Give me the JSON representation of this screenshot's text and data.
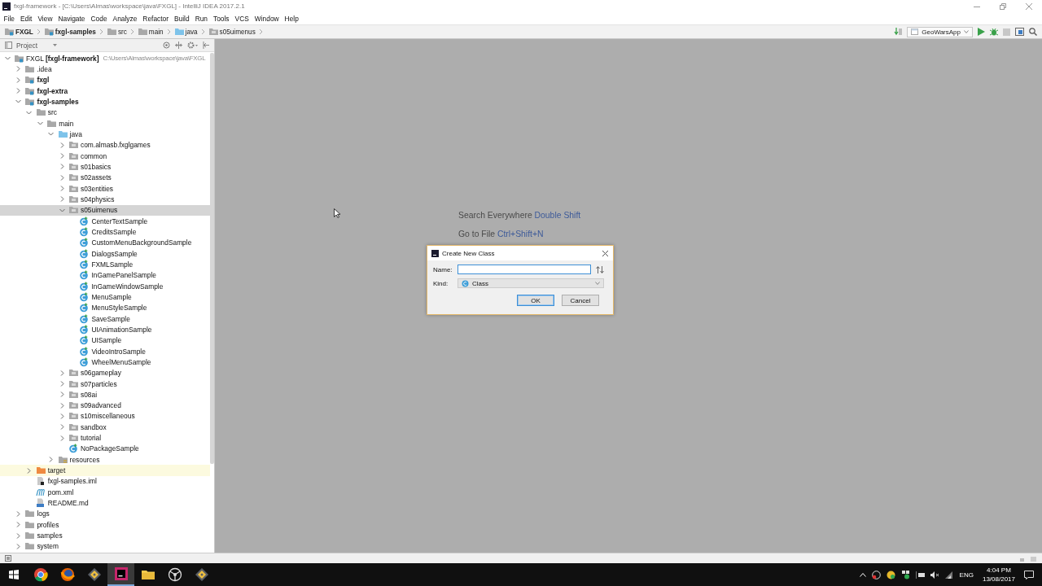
{
  "window": {
    "title": "fxgl-framework - [C:\\Users\\Almas\\workspace\\java\\FXGL] - IntelliJ IDEA 2017.2.1"
  },
  "menu": [
    "File",
    "Edit",
    "View",
    "Navigate",
    "Code",
    "Analyze",
    "Refactor",
    "Build",
    "Run",
    "Tools",
    "VCS",
    "Window",
    "Help"
  ],
  "breadcrumbs": [
    {
      "label": "FXGL",
      "kind": "module"
    },
    {
      "label": "fxgl-samples",
      "kind": "module"
    },
    {
      "label": "src",
      "kind": "folder"
    },
    {
      "label": "main",
      "kind": "folder"
    },
    {
      "label": "java",
      "kind": "source"
    },
    {
      "label": "s05uimenus",
      "kind": "package"
    }
  ],
  "toolbar": {
    "run_config": "GeoWarsApp",
    "stop_disabled": true
  },
  "project_panel": {
    "title": "Project",
    "tree": [
      {
        "label": "FXGL **[fxgl-framework]**",
        "path": "C:\\Users\\Almas\\workspace\\java\\FXGL",
        "kind": "project",
        "expanded": true,
        "selected": false,
        "children": [
          {
            "label": ".idea",
            "kind": "folder",
            "expanded": false,
            "selected": false
          },
          {
            "label": "fxgl",
            "kind": "module",
            "expanded": false,
            "selected": false
          },
          {
            "label": "fxgl-extra",
            "kind": "module",
            "expanded": false,
            "selected": false
          },
          {
            "label": "fxgl-samples",
            "kind": "module",
            "expanded": true,
            "selected": false,
            "children": [
              {
                "label": "src",
                "kind": "folder",
                "expanded": true,
                "selected": false,
                "children": [
                  {
                    "label": "main",
                    "kind": "folder",
                    "expanded": true,
                    "selected": false,
                    "children": [
                      {
                        "label": "java",
                        "kind": "source",
                        "expanded": true,
                        "selected": false,
                        "children": [
                          {
                            "label": "com.almasb.fxglgames",
                            "kind": "package",
                            "expanded": false,
                            "selected": false
                          },
                          {
                            "label": "common",
                            "kind": "package",
                            "expanded": false,
                            "selected": false
                          },
                          {
                            "label": "s01basics",
                            "kind": "package",
                            "expanded": false,
                            "selected": false
                          },
                          {
                            "label": "s02assets",
                            "kind": "package",
                            "expanded": false,
                            "selected": false
                          },
                          {
                            "label": "s03entities",
                            "kind": "package",
                            "expanded": false,
                            "selected": false
                          },
                          {
                            "label": "s04physics",
                            "kind": "package",
                            "expanded": false,
                            "selected": false
                          },
                          {
                            "label": "s05uimenus",
                            "kind": "package",
                            "expanded": true,
                            "selected": true,
                            "children": [
                              {
                                "label": "CenterTextSample",
                                "kind": "class",
                                "selected": false
                              },
                              {
                                "label": "CreditsSample",
                                "kind": "class",
                                "selected": false
                              },
                              {
                                "label": "CustomMenuBackgroundSample",
                                "kind": "class",
                                "selected": false
                              },
                              {
                                "label": "DialogsSample",
                                "kind": "class",
                                "selected": false
                              },
                              {
                                "label": "FXMLSample",
                                "kind": "class",
                                "selected": false
                              },
                              {
                                "label": "InGamePanelSample",
                                "kind": "class",
                                "selected": false
                              },
                              {
                                "label": "InGameWindowSample",
                                "kind": "class",
                                "selected": false
                              },
                              {
                                "label": "MenuSample",
                                "kind": "class",
                                "selected": false
                              },
                              {
                                "label": "MenuStyleSample",
                                "kind": "class",
                                "selected": false
                              },
                              {
                                "label": "SaveSample",
                                "kind": "class",
                                "selected": false
                              },
                              {
                                "label": "UIAnimationSample",
                                "kind": "class",
                                "selected": false
                              },
                              {
                                "label": "UISample",
                                "kind": "class",
                                "selected": false
                              },
                              {
                                "label": "VideoIntroSample",
                                "kind": "class",
                                "selected": false
                              },
                              {
                                "label": "WheelMenuSample",
                                "kind": "class",
                                "selected": false
                              }
                            ]
                          },
                          {
                            "label": "s06gameplay",
                            "kind": "package",
                            "expanded": false,
                            "selected": false
                          },
                          {
                            "label": "s07particles",
                            "kind": "package",
                            "expanded": false,
                            "selected": false
                          },
                          {
                            "label": "s08ai",
                            "kind": "package",
                            "expanded": false,
                            "selected": false
                          },
                          {
                            "label": "s09advanced",
                            "kind": "package",
                            "expanded": false,
                            "selected": false
                          },
                          {
                            "label": "s10miscellaneous",
                            "kind": "package",
                            "expanded": false,
                            "selected": false
                          },
                          {
                            "label": "sandbox",
                            "kind": "package",
                            "expanded": false,
                            "selected": false
                          },
                          {
                            "label": "tutorial",
                            "kind": "package",
                            "expanded": false,
                            "selected": false
                          },
                          {
                            "label": "NoPackageSample",
                            "kind": "class",
                            "selected": false
                          }
                        ]
                      },
                      {
                        "label": "resources",
                        "kind": "resources",
                        "expanded": false,
                        "selected": false
                      }
                    ]
                  }
                ]
              },
              {
                "label": "target",
                "kind": "excluded",
                "expanded": false,
                "selected": false
              },
              {
                "label": "fxgl-samples.iml",
                "kind": "iml",
                "selected": false
              },
              {
                "label": "pom.xml",
                "kind": "pom",
                "selected": false
              },
              {
                "label": "README.md",
                "kind": "markdown",
                "selected": false
              }
            ]
          },
          {
            "label": "logs",
            "kind": "folder",
            "expanded": false,
            "selected": false
          },
          {
            "label": "profiles",
            "kind": "folder",
            "expanded": false,
            "selected": false
          },
          {
            "label": "samples",
            "kind": "folder",
            "expanded": false,
            "selected": false
          },
          {
            "label": "system",
            "kind": "folder",
            "expanded": false,
            "selected": false
          }
        ]
      }
    ]
  },
  "editor": {
    "hints": [
      {
        "action": "Search Everywhere",
        "shortcut": "Double Shift"
      },
      {
        "action": "Go to File",
        "shortcut": "Ctrl+Shift+N"
      }
    ]
  },
  "dialog": {
    "title": "Create New Class",
    "name_label": "Name:",
    "name_focused": true,
    "kind_label": "Kind:",
    "kind_value": "Class",
    "buttons": [
      {
        "label": "OK",
        "default": true
      },
      {
        "label": "Cancel",
        "default": false
      }
    ]
  },
  "taskbar": {
    "apps": [
      {
        "kind": "chrome",
        "active": false
      },
      {
        "kind": "firefox",
        "active": false
      },
      {
        "kind": "git",
        "active": false
      },
      {
        "kind": "idea",
        "active": true
      },
      {
        "kind": "explorer",
        "active": false
      },
      {
        "kind": "steam",
        "active": false
      },
      {
        "kind": "git",
        "active": false
      }
    ],
    "language": "ENG",
    "time": "4:04 PM",
    "date": "13/08/2017"
  }
}
